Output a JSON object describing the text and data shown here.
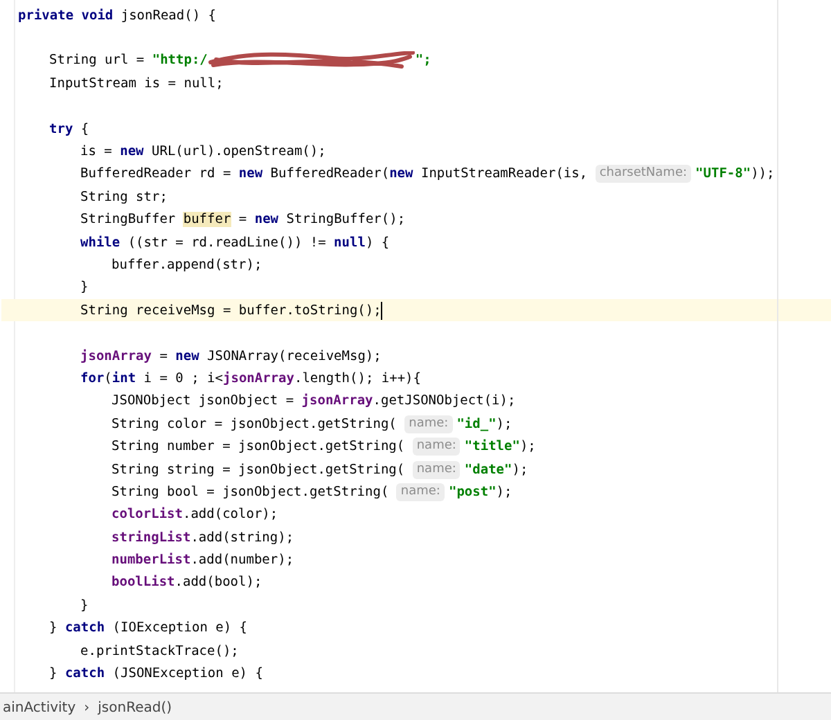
{
  "editor": {
    "lines": [
      {
        "current": false,
        "tokens": [
          {
            "kind": "keyword",
            "text": "private void"
          },
          {
            "kind": "plain",
            "text": " jsonRead() {"
          }
        ],
        "children": [
          {
            "current": false
          },
          {
            "current": false,
            "tokens": [
              {
                "kind": "plain",
                "text": "String url = "
              },
              {
                "kind": "string",
                "text": "\"http:/"
              },
              {
                "kind": "redacted"
              },
              {
                "kind": "string",
                "text": "\";"
              }
            ]
          },
          {
            "current": false,
            "tokens": [
              {
                "kind": "plain",
                "text": "InputStream is = null;"
              }
            ]
          },
          {
            "current": false
          },
          {
            "current": false,
            "tokens": [
              {
                "kind": "keyword",
                "text": "try"
              },
              {
                "kind": "plain",
                "text": " {"
              }
            ],
            "children": [
              {
                "current": false,
                "tokens": [
                  {
                    "kind": "plain",
                    "text": "is = "
                  },
                  {
                    "kind": "keyword",
                    "text": "new"
                  },
                  {
                    "kind": "plain",
                    "text": " URL(url).openStream();"
                  }
                ]
              },
              {
                "current": false,
                "tokens": [
                  {
                    "kind": "plain",
                    "text": "BufferedReader rd = "
                  },
                  {
                    "kind": "keyword",
                    "text": "new"
                  },
                  {
                    "kind": "plain",
                    "text": " BufferedReader("
                  },
                  {
                    "kind": "keyword",
                    "text": "new"
                  },
                  {
                    "kind": "plain",
                    "text": " InputStreamReader(is, "
                  },
                  {
                    "kind": "hint",
                    "text": "charsetName:"
                  },
                  {
                    "kind": "string",
                    "text": "\"UTF-8\""
                  },
                  {
                    "kind": "plain",
                    "text": "));"
                  }
                ]
              },
              {
                "current": false,
                "tokens": [
                  {
                    "kind": "plain",
                    "text": "String str;"
                  }
                ]
              },
              {
                "current": false,
                "tokens": [
                  {
                    "kind": "plain",
                    "text": "StringBuffer "
                  },
                  {
                    "kind": "match",
                    "text": "buffer"
                  },
                  {
                    "kind": "plain",
                    "text": " = "
                  },
                  {
                    "kind": "keyword",
                    "text": "new"
                  },
                  {
                    "kind": "plain",
                    "text": " StringBuffer();"
                  }
                ]
              },
              {
                "current": false,
                "tokens": [
                  {
                    "kind": "keyword",
                    "text": "while"
                  },
                  {
                    "kind": "plain",
                    "text": " ((str = rd.readLine()) != "
                  },
                  {
                    "kind": "keyword",
                    "text": "null"
                  },
                  {
                    "kind": "plain",
                    "text": ") {"
                  }
                ],
                "children": [
                  {
                    "current": false,
                    "tokens": [
                      {
                        "kind": "plain",
                        "text": "buffer.append(str);"
                      }
                    ]
                  }
                ]
              },
              {
                "current": false,
                "tokens": [
                  {
                    "kind": "plain",
                    "text": "}"
                  }
                ]
              },
              {
                "current": true,
                "tokens": [
                  {
                    "kind": "plain",
                    "text": "String receiveMsg = buffer.toString();"
                  }
                ]
              },
              {
                "current": false
              },
              {
                "current": false,
                "tokens": [
                  {
                    "kind": "field",
                    "text": "jsonArray"
                  },
                  {
                    "kind": "plain",
                    "text": " = "
                  },
                  {
                    "kind": "keyword",
                    "text": "new"
                  },
                  {
                    "kind": "plain",
                    "text": " JSONArray(receiveMsg);"
                  }
                ]
              },
              {
                "current": false,
                "tokens": [
                  {
                    "kind": "keyword",
                    "text": "for"
                  },
                  {
                    "kind": "plain",
                    "text": "("
                  },
                  {
                    "kind": "keyword",
                    "text": "int"
                  },
                  {
                    "kind": "plain",
                    "text": " i = 0 ; i<"
                  },
                  {
                    "kind": "field",
                    "text": "jsonArray"
                  },
                  {
                    "kind": "plain",
                    "text": ".length(); i++){"
                  }
                ],
                "children": [
                  {
                    "current": false,
                    "tokens": [
                      {
                        "kind": "plain",
                        "text": "JSONObject jsonObject = "
                      },
                      {
                        "kind": "field",
                        "text": "jsonArray"
                      },
                      {
                        "kind": "plain",
                        "text": ".getJSONObject(i);"
                      }
                    ]
                  },
                  {
                    "current": false,
                    "tokens": [
                      {
                        "kind": "plain",
                        "text": "String color = jsonObject.getString( "
                      },
                      {
                        "kind": "hint",
                        "text": "name:"
                      },
                      {
                        "kind": "string",
                        "text": "\"id_\""
                      },
                      {
                        "kind": "plain",
                        "text": ");"
                      }
                    ]
                  },
                  {
                    "current": false,
                    "tokens": [
                      {
                        "kind": "plain",
                        "text": "String number = jsonObject.getString( "
                      },
                      {
                        "kind": "hint",
                        "text": "name:"
                      },
                      {
                        "kind": "string",
                        "text": "\"title\""
                      },
                      {
                        "kind": "plain",
                        "text": ");"
                      }
                    ]
                  },
                  {
                    "current": false,
                    "tokens": [
                      {
                        "kind": "plain",
                        "text": "String string = jsonObject.getString( "
                      },
                      {
                        "kind": "hint",
                        "text": "name:"
                      },
                      {
                        "kind": "string",
                        "text": "\"date\""
                      },
                      {
                        "kind": "plain",
                        "text": ");"
                      }
                    ]
                  },
                  {
                    "current": false,
                    "tokens": [
                      {
                        "kind": "plain",
                        "text": "String bool = jsonObject.getString( "
                      },
                      {
                        "kind": "hint",
                        "text": "name:"
                      },
                      {
                        "kind": "string",
                        "text": "\"post\""
                      },
                      {
                        "kind": "plain",
                        "text": ");"
                      }
                    ]
                  },
                  {
                    "current": false,
                    "tokens": [
                      {
                        "kind": "field",
                        "text": "colorList"
                      },
                      {
                        "kind": "plain",
                        "text": ".add(color);"
                      }
                    ]
                  },
                  {
                    "current": false,
                    "tokens": [
                      {
                        "kind": "field",
                        "text": "stringList"
                      },
                      {
                        "kind": "plain",
                        "text": ".add(string);"
                      }
                    ]
                  },
                  {
                    "current": false,
                    "tokens": [
                      {
                        "kind": "field",
                        "text": "numberList"
                      },
                      {
                        "kind": "plain",
                        "text": ".add(number);"
                      }
                    ]
                  },
                  {
                    "current": false,
                    "tokens": [
                      {
                        "kind": "field",
                        "text": "boolList"
                      },
                      {
                        "kind": "plain",
                        "text": ".add(bool);"
                      }
                    ]
                  }
                ]
              },
              {
                "current": false,
                "tokens": [
                  {
                    "kind": "plain",
                    "text": "}"
                  }
                ]
              }
            ]
          },
          {
            "current": false,
            "tokens": [
              {
                "kind": "plain",
                "text": "} "
              },
              {
                "kind": "keyword",
                "text": "catch"
              },
              {
                "kind": "plain",
                "text": " (IOException e) {"
              }
            ],
            "children": [
              {
                "current": false,
                "tokens": [
                  {
                    "kind": "plain",
                    "text": "e.printStackTrace();"
                  }
                ]
              }
            ]
          },
          {
            "current": false,
            "tokens": [
              {
                "kind": "plain",
                "text": "} "
              },
              {
                "kind": "keyword",
                "text": "catch"
              },
              {
                "kind": "plain",
                "text": " (JSONException e) {"
              }
            ]
          }
        ]
      }
    ]
  },
  "breadcrumb": [
    "ainActivity",
    "›",
    "jsonRead()"
  ]
}
